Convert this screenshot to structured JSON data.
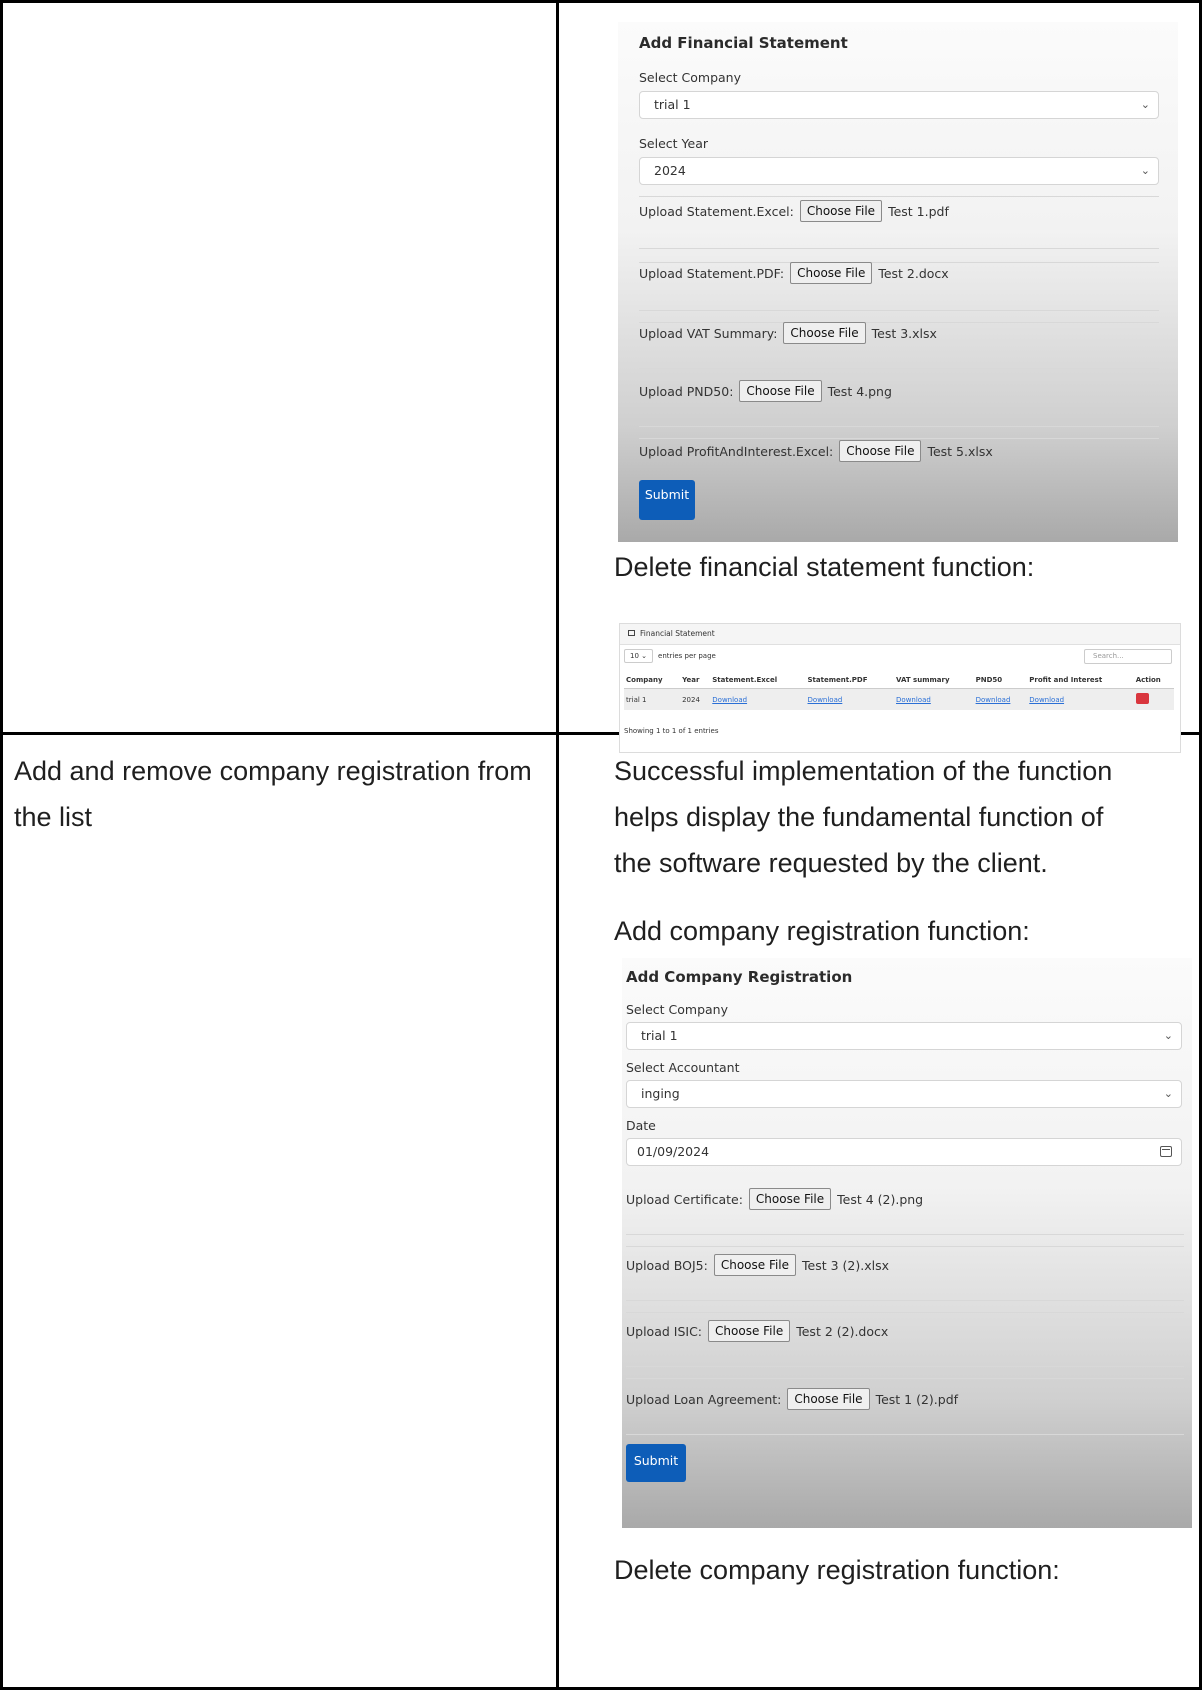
{
  "row1": {
    "right": {
      "fin_form": {
        "title": "Add Financial Statement",
        "company_label": "Select Company",
        "company_value": "trial 1",
        "year_label": "Select Year",
        "year_value": "2024",
        "uploads": [
          {
            "label": "Upload Statement.Excel:",
            "button": "Choose File",
            "file": "Test 1.pdf"
          },
          {
            "label": "Upload Statement.PDF:",
            "button": "Choose File",
            "file": "Test 2.docx"
          },
          {
            "label": "Upload VAT Summary:",
            "button": "Choose File",
            "file": "Test 3.xlsx"
          },
          {
            "label": "Upload PND50:",
            "button": "Choose File",
            "file": "Test 4.png"
          },
          {
            "label": "Upload ProfitAndInterest.Excel:",
            "button": "Choose File",
            "file": "Test 5.xlsx"
          }
        ],
        "submit": "Submit"
      },
      "delete_caption": "Delete financial statement function:",
      "table": {
        "title": "Financial Statement",
        "per_page_value": "10",
        "per_page_label": "entries per page",
        "search_placeholder": "Search...",
        "columns": [
          "Company",
          "Year",
          "Statement.Excel",
          "Statement.PDF",
          "VAT summary",
          "PND50",
          "Profit and Interest",
          "Action"
        ],
        "rows": [
          {
            "company": "trial 1",
            "year": "2024",
            "excel": "Download",
            "pdf": "Download",
            "vat": "Download",
            "pnd": "Download",
            "profit": "Download"
          }
        ],
        "footer": "Showing 1 to 1 of 1 entries"
      }
    }
  },
  "row2": {
    "left_text": [
      "Add and remove company registration from",
      "the list"
    ],
    "right_text": [
      "Successful implementation of the function",
      "helps display the fundamental function of",
      "the software requested by the client."
    ],
    "add_caption": "Add company registration function:",
    "reg_form": {
      "title": "Add Company Registration",
      "company_label": "Select Company",
      "company_value": "trial 1",
      "accountant_label": "Select Accountant",
      "accountant_value": "inging",
      "date_label": "Date",
      "date_value": "01/09/2024",
      "uploads": [
        {
          "label": "Upload Certificate:",
          "button": "Choose File",
          "file": "Test 4 (2).png"
        },
        {
          "label": "Upload BOJ5:",
          "button": "Choose File",
          "file": "Test 3 (2).xlsx"
        },
        {
          "label": "Upload ISIC:",
          "button": "Choose File",
          "file": "Test 2 (2).docx"
        },
        {
          "label": "Upload Loan Agreement:",
          "button": "Choose File",
          "file": "Test 1 (2).pdf"
        }
      ],
      "submit": "Submit"
    },
    "delete_caption": "Delete company registration function:"
  }
}
